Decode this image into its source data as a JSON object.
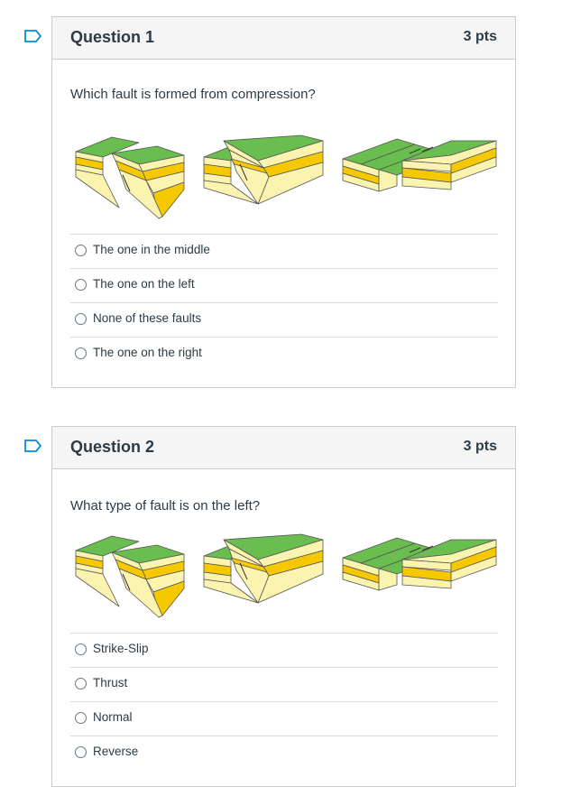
{
  "questions": [
    {
      "title": "Question 1",
      "points": "3 pts",
      "prompt": "Which fault is formed from compression?",
      "answers": [
        "The one in the middle",
        "The one on the left",
        "None of these faults",
        "The one on the right"
      ]
    },
    {
      "title": "Question 2",
      "points": "3 pts",
      "prompt": "What type of fault is on the left?",
      "answers": [
        "Strike-Slip",
        "Thrust",
        "Normal",
        "Reverse"
      ]
    }
  ],
  "colors": {
    "layer_top": "#6abd4f",
    "layer_yellow": "#f5c800",
    "layer_pale": "#fbf4b0",
    "outline": "#555555",
    "flag": "#008ee2"
  },
  "icons": {
    "flag": "bookmark-flag-icon",
    "radio": "radio-empty-icon"
  }
}
